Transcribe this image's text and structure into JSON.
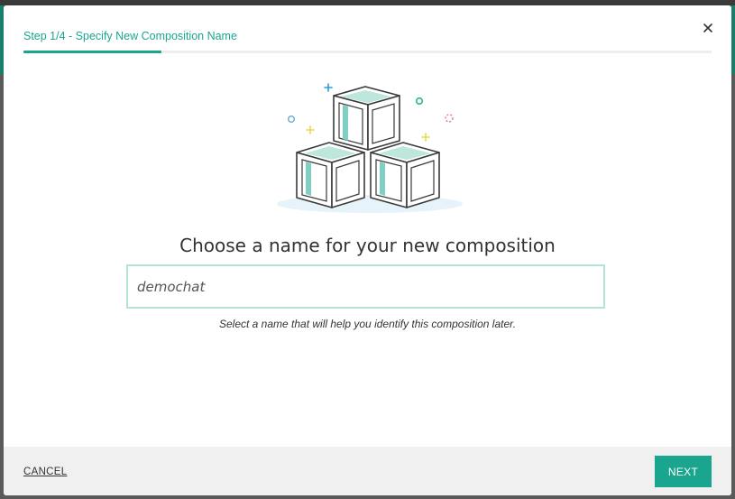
{
  "dialog": {
    "step_title": "Step 1/4 - Specify New Composition Name",
    "progress_fraction": 0.2,
    "heading": "Choose a name for your new composition",
    "name_input": {
      "value": "demochat",
      "placeholder": ""
    },
    "helper_text": "Select a name that will help you identify this composition later.",
    "close_icon": "close-icon",
    "illustration_icon": "stacked-cubes-illustration"
  },
  "footer": {
    "cancel_label": "CANCEL",
    "next_label": "NEXT"
  },
  "colors": {
    "accent": "#1aa58f",
    "input_border": "#b5e3da",
    "footer_bg": "#f0f0f0",
    "heading_text": "#333333"
  }
}
